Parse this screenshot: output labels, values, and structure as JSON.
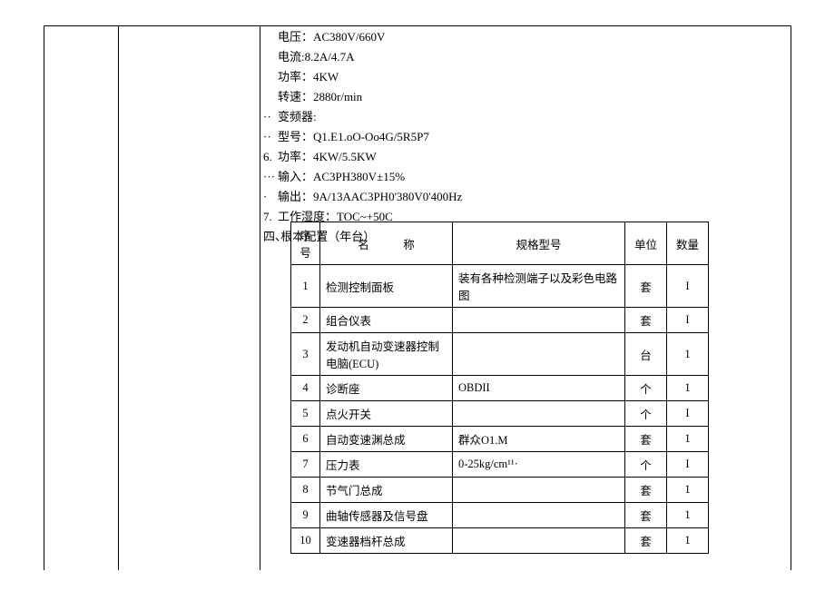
{
  "specs": [
    {
      "label": "",
      "text": "电压：AC380V/660V"
    },
    {
      "label": "",
      "text": "电流:8.2A/4.7A"
    },
    {
      "label": "",
      "text": "功率：4KW"
    },
    {
      "label": "",
      "text": "转速：2880r/min"
    },
    {
      "label": "··",
      "text": "变频器:"
    },
    {
      "label": "··",
      "text": "型号：Q1.E1.oO-Oo4G/5R5P7"
    },
    {
      "label": "6.",
      "text": "功率：4KW/5.5KW"
    },
    {
      "label": "···",
      "text": "输入：AC3PH380V±15%"
    },
    {
      "label": "·",
      "text": "输出：9A/13AAC3PH0'380V0'400Hz"
    },
    {
      "label": "7.",
      "text": "工作湿度：TOC~+50C"
    }
  ],
  "section": {
    "label": "四、",
    "text": "根本配置（年台）"
  },
  "table": {
    "headers": {
      "seq": "序号",
      "name": "名　　　称",
      "spec": "规格型号",
      "unit": "单位",
      "qty": "数量"
    },
    "rows": [
      {
        "seq": "1",
        "name": "检测控制面板",
        "spec": "装有各种检测端子以及彩色电路图",
        "unit": "套",
        "qty": "I"
      },
      {
        "seq": "2",
        "name": "组合仪表",
        "spec": "",
        "unit": "套",
        "qty": "I"
      },
      {
        "seq": "3",
        "name": "发动机自动变速器控制电脑(ECU)",
        "spec": "",
        "unit": "台",
        "qty": "1"
      },
      {
        "seq": "4",
        "name": "诊断座",
        "spec": "OBDII",
        "unit": "个",
        "qty": "1"
      },
      {
        "seq": "5",
        "name": "点火开关",
        "spec": "",
        "unit": "个",
        "qty": "I"
      },
      {
        "seq": "6",
        "name": "自动变速渊总成",
        "spec": "群众O1.M",
        "unit": "套",
        "qty": "1"
      },
      {
        "seq": "7",
        "name": "压力表",
        "spec": "0-25kg/cm¹¹·",
        "unit": "个",
        "qty": "I"
      },
      {
        "seq": "8",
        "name": "节气门总成",
        "spec": "",
        "unit": "套",
        "qty": "1"
      },
      {
        "seq": "9",
        "name": "曲轴传感器及信号盘",
        "spec": "",
        "unit": "套",
        "qty": "1"
      },
      {
        "seq": "10",
        "name": "变速器档杆总成",
        "spec": "",
        "unit": "套",
        "qty": "1"
      }
    ]
  }
}
